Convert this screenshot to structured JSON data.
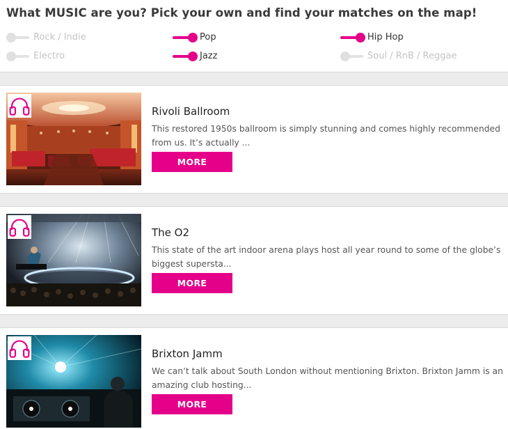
{
  "heading": "What MUSIC are you? Pick your own and find your matches on the map!",
  "genres": [
    {
      "label": "Rock / Indie",
      "on": false
    },
    {
      "label": "Pop",
      "on": true
    },
    {
      "label": "Hip Hop",
      "on": true
    },
    {
      "label": "Electro",
      "on": false
    },
    {
      "label": "Jazz",
      "on": true
    },
    {
      "label": "Soul / RnB / Reggae",
      "on": false
    }
  ],
  "venues": [
    {
      "badge_icon": "headphones-icon",
      "title": "Rivoli Ballroom",
      "description": "This restored 1950s ballroom is simply stunning and comes highly recommended from us. It’s actually ...",
      "button_label": "MORE"
    },
    {
      "badge_icon": "headphones-icon",
      "title": "The O2",
      "description": "This state of the art indoor arena plays host all year round to some of the globe’s biggest supersta...",
      "button_label": "MORE"
    },
    {
      "badge_icon": "headphones-icon",
      "title": "Brixton Jamm",
      "description": "We can’t talk about South London without mentioning Brixton. Brixton Jamm is an amazing club hosting...",
      "button_label": "MORE"
    }
  ],
  "colors": {
    "accent": "#e5008a",
    "band": "#ececec",
    "toggle_off": "#e0e0e0"
  }
}
